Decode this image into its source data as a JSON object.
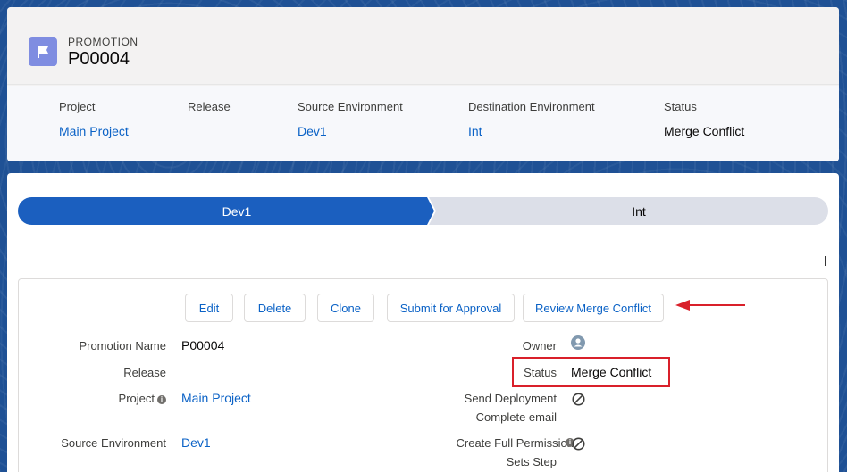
{
  "header": {
    "record_type": "PROMOTION",
    "record_name": "P00004",
    "icon": "flag-icon",
    "fields": [
      {
        "label": "Project",
        "value": "Main Project",
        "is_link": true
      },
      {
        "label": "Release",
        "value": "",
        "is_link": false
      },
      {
        "label": "Source Environment",
        "value": "Dev1",
        "is_link": true
      },
      {
        "label": "Destination Environment",
        "value": "Int",
        "is_link": true
      },
      {
        "label": "Status",
        "value": "Merge Conflict",
        "is_link": false
      }
    ]
  },
  "path": {
    "stages": [
      {
        "label": "Dev1",
        "active": true
      },
      {
        "label": "Int",
        "active": false
      }
    ]
  },
  "actions": {
    "edit": "Edit",
    "delete": "Delete",
    "clone": "Clone",
    "submit": "Submit for Approval",
    "review": "Review Merge Conflict"
  },
  "details": {
    "promotion_name_label": "Promotion Name",
    "promotion_name_value": "P00004",
    "release_label": "Release",
    "project_label": "Project",
    "project_value": "Main Project",
    "source_env_label": "Source Environment",
    "source_env_value": "Dev1",
    "owner_label": "Owner",
    "status_label": "Status",
    "status_value": "Merge Conflict",
    "send_email_label_1": "Send Deployment",
    "send_email_label_2": "Complete email",
    "full_perm_label_1": "Create Full Permission",
    "full_perm_label_2": "Sets Step"
  },
  "colors": {
    "brand_blue": "#0b62c6",
    "path_active": "#1b5fbf",
    "path_inactive": "#dcdfe8",
    "highlight_red": "#d9202a"
  }
}
